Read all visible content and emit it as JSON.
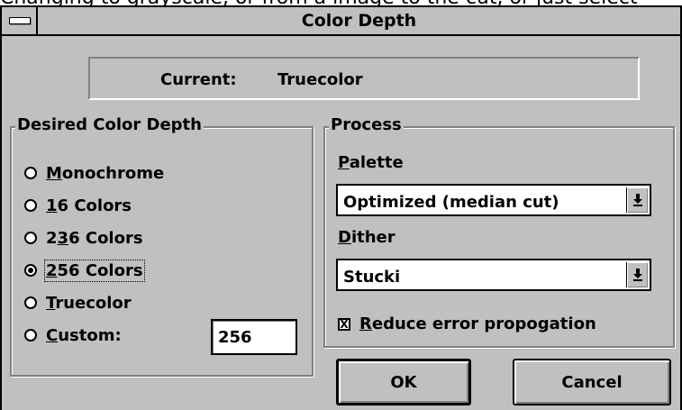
{
  "caption_fragment": "Changing to grayscale, or from a image to the cut, or just select",
  "title": "Color Depth",
  "current": {
    "label": "Current:",
    "value": "Truecolor"
  },
  "desired": {
    "title": "Desired Color Depth",
    "options": [
      {
        "pre": "",
        "u": "M",
        "post": "onochrome",
        "checked": false
      },
      {
        "pre": "",
        "u": "1",
        "post": "6 Colors",
        "checked": false
      },
      {
        "pre": "2",
        "u": "3",
        "post": "6 Colors",
        "checked": false
      },
      {
        "pre": "",
        "u": "2",
        "post": "56 Colors",
        "checked": true
      },
      {
        "pre": "",
        "u": "T",
        "post": "ruecolor",
        "checked": false
      },
      {
        "pre": "",
        "u": "C",
        "post": "ustom:",
        "checked": false
      }
    ],
    "custom_value": "256"
  },
  "process": {
    "title": "Process",
    "palette_label_u": "P",
    "palette_label_rest": "alette",
    "palette_value": "Optimized (median cut)",
    "dither_label_u": "D",
    "dither_label_rest": "ither",
    "dither_value": "Stucki",
    "reduce_u": "R",
    "reduce_rest": "educe error propogation",
    "reduce_checked_mark": "X"
  },
  "buttons": {
    "ok": "OK",
    "cancel": "Cancel"
  },
  "icons": {
    "dropdown": "down-arrow-with-bar-icon",
    "system_menu": "system-menu-icon"
  }
}
